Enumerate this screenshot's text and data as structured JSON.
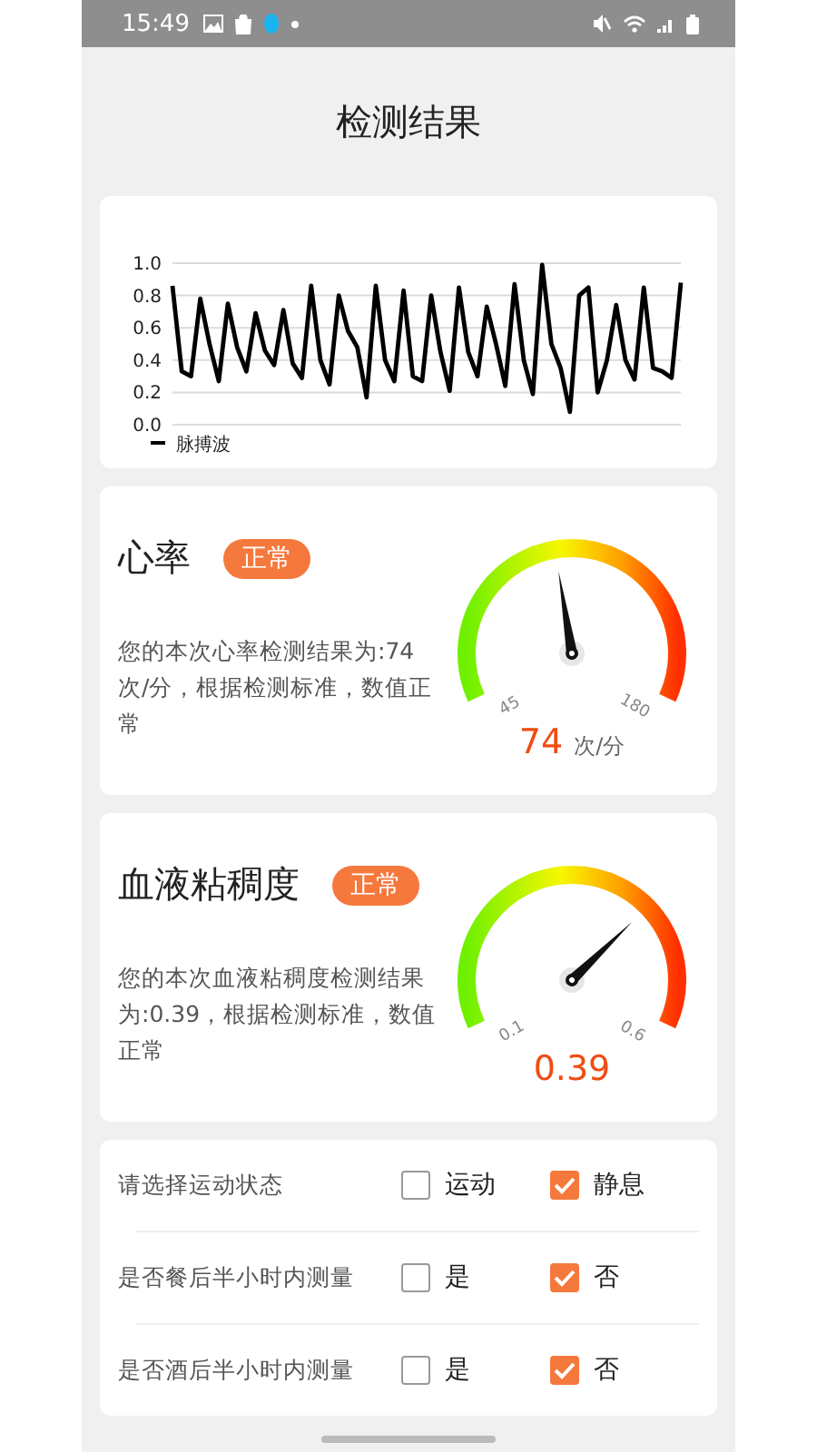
{
  "status_bar": {
    "time": "15:49"
  },
  "title": "检测结果",
  "pulse_chart": {
    "chart_data": {
      "type": "line",
      "grid": true,
      "yticks": [
        {
          "value": 0,
          "label": "0.0"
        },
        0.2,
        0.4,
        0.6,
        0.8,
        {
          "value": 1,
          "label": "1.0"
        }
      ],
      "ylim": [
        0,
        1
      ],
      "series": [
        {
          "name": "脉搏波",
          "color": "#000000",
          "values": [
            0.86,
            0.33,
            0.3,
            0.78,
            0.5,
            0.27,
            0.75,
            0.48,
            0.33,
            0.69,
            0.46,
            0.37,
            0.71,
            0.38,
            0.29,
            0.86,
            0.4,
            0.25,
            0.8,
            0.58,
            0.48,
            0.17,
            0.86,
            0.4,
            0.27,
            0.83,
            0.3,
            0.27,
            0.8,
            0.45,
            0.21,
            0.85,
            0.45,
            0.3,
            0.73,
            0.5,
            0.24,
            0.87,
            0.4,
            0.19,
            0.99,
            0.5,
            0.35,
            0.08,
            0.8,
            0.85,
            0.2,
            0.4,
            0.74,
            0.4,
            0.28,
            0.85,
            0.35,
            0.33,
            0.29,
            0.88
          ]
        }
      ]
    }
  },
  "results": [
    {
      "name": "心率",
      "badge": "正常",
      "description": "您的本次心率检测结果为:74次/分，根据检测标准，数值正常",
      "gauge": {
        "min_label": "45",
        "max_label": "180"
      },
      "value": "74",
      "unit": "次/分"
    },
    {
      "name": "血液粘稠度",
      "badge": "正常",
      "description": "您的本次血液粘稠度检测结果为:0.39，根据检测标准，数值正常",
      "gauge": {
        "min_label": "0.1",
        "max_label": "0.6"
      },
      "value": "0.39"
    }
  ],
  "questions": [
    {
      "label": "请选择运动状态",
      "options": [
        {
          "label": "运动",
          "checked": false
        },
        {
          "label": "静息",
          "checked": true
        }
      ]
    },
    {
      "label": "是否餐后半小时内测量",
      "options": [
        {
          "label": "是",
          "checked": false
        },
        {
          "label": "否",
          "checked": true
        }
      ]
    },
    {
      "label": "是否酒后半小时内测量",
      "options": [
        {
          "label": "是",
          "checked": false
        },
        {
          "label": "否",
          "checked": true
        }
      ]
    }
  ]
}
